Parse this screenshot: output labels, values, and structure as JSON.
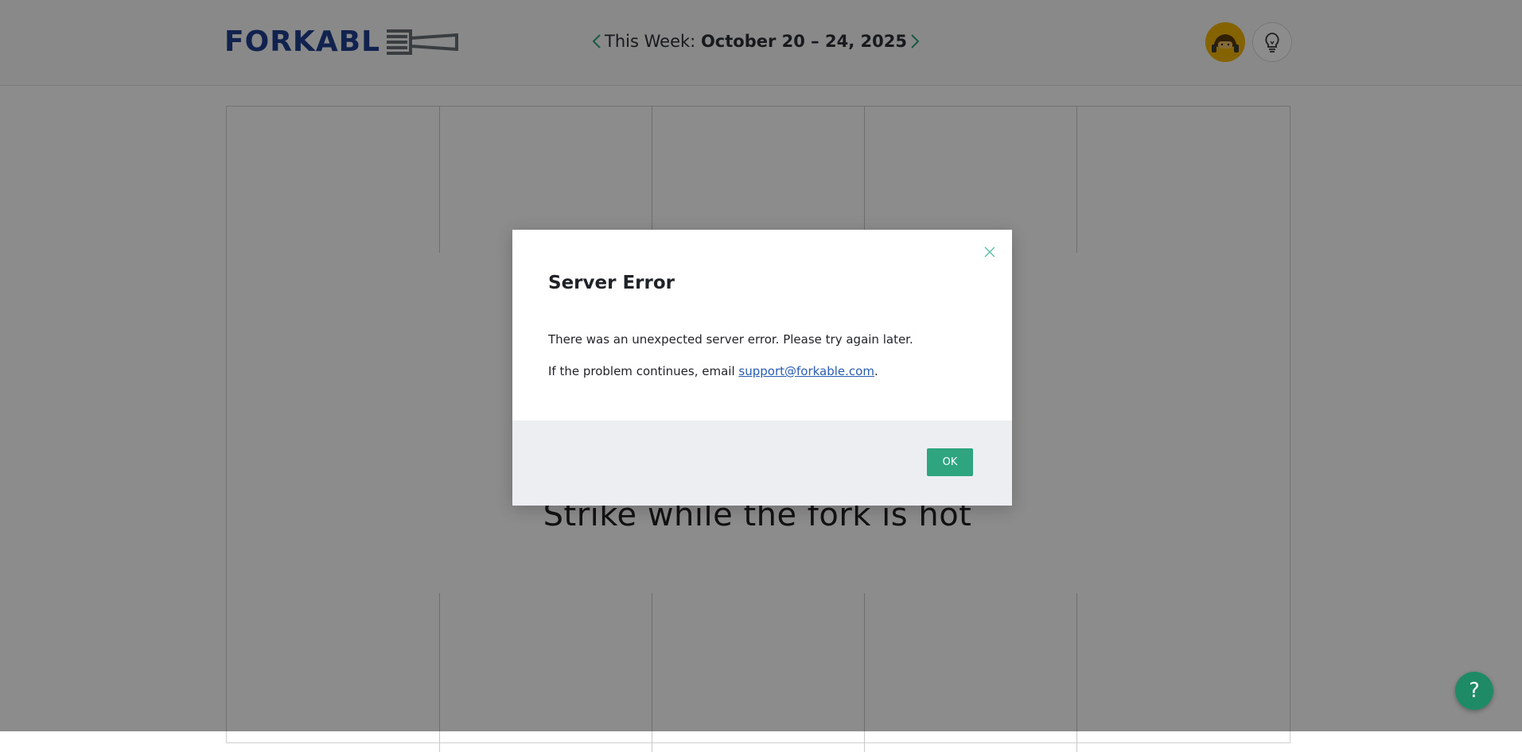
{
  "header": {
    "logo_text": "FORKABL",
    "week_prefix": "This Week:",
    "week_range": "October 20 – 24, 2025"
  },
  "main": {
    "tagline": "Strike while the fork is hot"
  },
  "modal": {
    "title": "Server Error",
    "message": "There was an unexpected server error. Please try again later.",
    "message2_prefix": "If the problem continues, email ",
    "support_email": "support@forkable.com",
    "message2_suffix": ".",
    "ok_label": "OK"
  },
  "help": {
    "label": "?"
  },
  "colors": {
    "brand_blue": "#1f3f8f",
    "accent_green": "#2fa57f",
    "avatar_bg": "#f0b400"
  },
  "icons": [
    "fork-logo-icon",
    "chevron-left-icon",
    "chevron-right-icon",
    "avatar-icon",
    "lightbulb-icon",
    "close-icon",
    "question-icon"
  ]
}
